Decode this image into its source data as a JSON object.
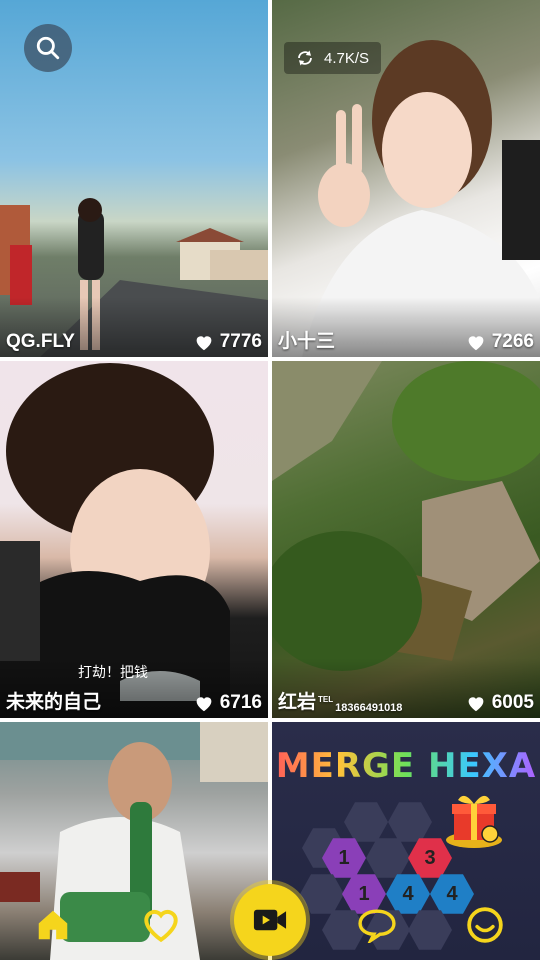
{
  "feed": {
    "cards": [
      {
        "name": "QG.FLY",
        "likes": "7776"
      },
      {
        "name": "小十三",
        "likes": "7266"
      },
      {
        "name": "未来的自己",
        "likes": "6716",
        "overlay_text": "打劫！把钱"
      },
      {
        "name": "红岩",
        "name_suffix": "TEL",
        "phone": "18366491018",
        "likes": "6005"
      },
      {
        "name": "",
        "likes": ""
      },
      {
        "ad_title": "MERGE HEXA"
      }
    ]
  },
  "status": {
    "network_speed": "4.7K/S"
  },
  "game": {
    "tiles": [
      "1",
      "3",
      "1",
      "4",
      "4"
    ]
  },
  "icons": {
    "search": "search-icon",
    "home": "home-icon",
    "favorites": "heart-icon",
    "camera": "video-camera-icon",
    "messages": "chat-bubble-icon",
    "profile": "smiley-icon"
  },
  "colors": {
    "accent_yellow": "#f5d51c",
    "hex_purple": "#8a3fb8",
    "hex_red": "#e0304a",
    "hex_blue": "#1f7fc6"
  }
}
